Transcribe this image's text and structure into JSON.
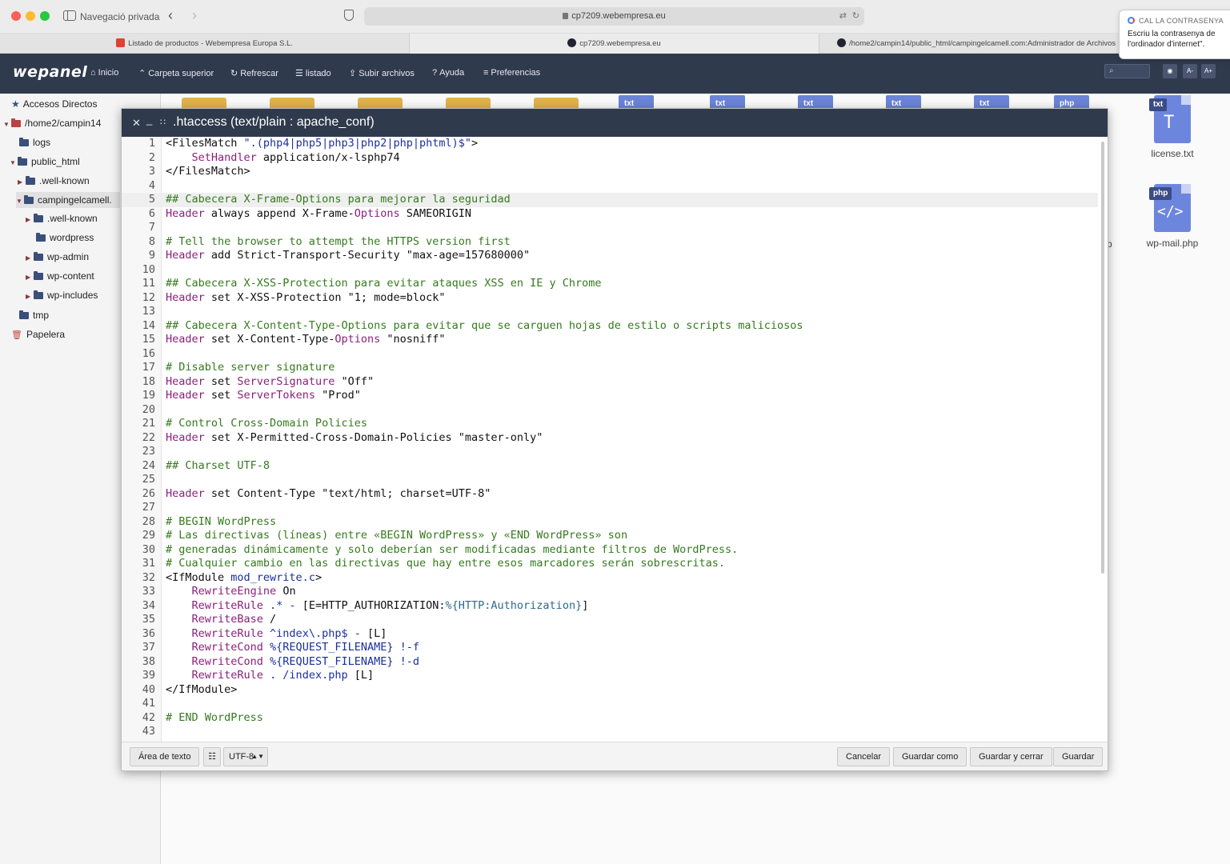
{
  "browser": {
    "private_label": "Navegació privada",
    "address": "cp7209.webempresa.eu",
    "tabs": [
      {
        "title": "Listado de productos - Webempresa Europa S.L."
      },
      {
        "title": "cp7209.webempresa.eu"
      },
      {
        "title": "/home2/campin14/public_html/campingelcamell.com:Administrador de Archivos"
      }
    ]
  },
  "password_popup": {
    "title": "CAL LA CONTRASENYA",
    "text": "Escriu la contrasenya de l'ordinador d'internet\"."
  },
  "app": {
    "logo": "wepanel",
    "toolbar": {
      "home": "Inicio",
      "parent": "Carpeta superior",
      "refresh": "Refrescar",
      "list": "listado",
      "upload": "Subir archivos",
      "help": "Ayuda",
      "prefs": "Preferencias"
    },
    "font_minus": "A-",
    "font_plus": "A+"
  },
  "tree": {
    "shortcuts": "Accesos Directos",
    "root": "/home2/campin14",
    "logs": "logs",
    "public_html": "public_html",
    "well_known_1": ".well-known",
    "campingelcamell": "campingelcamell.",
    "well_known_2": ".well-known",
    "wordpress": "wordpress",
    "wp_admin": "wp-admin",
    "wp_content": "wp-content",
    "wp_includes": "wp-includes",
    "tmp": "tmp",
    "trash": "Papelera"
  },
  "files": {
    "bg_badges": [
      "txt",
      "txt",
      "txt",
      "txt",
      "txt",
      "php"
    ],
    "license": {
      "badge": "txt",
      "name": "license.txt"
    },
    "wp_mail": {
      "badge": "php",
      "name": "wp-mail.php"
    },
    "partial_label": "p"
  },
  "editor": {
    "title": ".htaccess (text/plain : apache_conf)",
    "active_line": 5,
    "lines": [
      [
        [
          "t",
          "<FilesMatch "
        ],
        [
          "s",
          "\".(php4|php5|php3|php2|php|phtml)$\""
        ],
        [
          "t",
          ">"
        ]
      ],
      [
        [
          "t",
          "    "
        ],
        [
          "k",
          "SetHandler"
        ],
        [
          "t",
          " application/x-lsphp74"
        ]
      ],
      [
        [
          "t",
          "</FilesMatch>"
        ]
      ],
      [],
      [
        [
          "c",
          "## Cabecera X-Frame-Options para mejorar la seguridad"
        ]
      ],
      [
        [
          "k",
          "Header"
        ],
        [
          "t",
          " always append X-Frame-"
        ],
        [
          "k",
          "Options"
        ],
        [
          "t",
          " SAMEORIGIN"
        ]
      ],
      [],
      [
        [
          "c",
          "# Tell the browser to attempt the HTTPS version first"
        ]
      ],
      [
        [
          "k",
          "Header"
        ],
        [
          "t",
          " add Strict-Transport-Security \"max-age=157680000\""
        ]
      ],
      [],
      [
        [
          "c",
          "## Cabecera X-XSS-Protection para evitar ataques XSS en IE y Chrome"
        ]
      ],
      [
        [
          "k",
          "Header"
        ],
        [
          "t",
          " set X-XSS-Protection \"1; mode=block\""
        ]
      ],
      [],
      [
        [
          "c",
          "## Cabecera X-Content-Type-Options para evitar que se carguen hojas de estilo o scripts maliciosos"
        ]
      ],
      [
        [
          "k",
          "Header"
        ],
        [
          "t",
          " set X-Content-Type-"
        ],
        [
          "k",
          "Options"
        ],
        [
          "t",
          " \"nosniff\""
        ]
      ],
      [],
      [
        [
          "c",
          "# Disable server signature"
        ]
      ],
      [
        [
          "k",
          "Header"
        ],
        [
          "t",
          " set "
        ],
        [
          "k",
          "ServerSignature"
        ],
        [
          "t",
          " \"Off\""
        ]
      ],
      [
        [
          "k",
          "Header"
        ],
        [
          "t",
          " set "
        ],
        [
          "k",
          "ServerTokens"
        ],
        [
          "t",
          " \"Prod\""
        ]
      ],
      [],
      [
        [
          "c",
          "# Control Cross-Domain Policies"
        ]
      ],
      [
        [
          "k",
          "Header"
        ],
        [
          "t",
          " set X-Permitted-Cross-Domain-Policies \"master-only\""
        ]
      ],
      [],
      [
        [
          "c",
          "## Charset UTF-8"
        ]
      ],
      [],
      [
        [
          "k",
          "Header"
        ],
        [
          "t",
          " set Content-Type \"text/html; charset=UTF-8\""
        ]
      ],
      [],
      [
        [
          "c",
          "# BEGIN WordPress"
        ]
      ],
      [
        [
          "c",
          "# Las directivas (líneas) entre «BEGIN WordPress» y «END WordPress» son"
        ]
      ],
      [
        [
          "c",
          "# generadas dinámicamente y solo deberían ser modificadas mediante filtros de WordPress."
        ]
      ],
      [
        [
          "c",
          "# Cualquier cambio en las directivas que hay entre esos marcadores serán sobrescritas."
        ]
      ],
      [
        [
          "t",
          "<IfModule "
        ],
        [
          "s",
          "mod_rewrite.c"
        ],
        [
          "t",
          ">"
        ]
      ],
      [
        [
          "t",
          "    "
        ],
        [
          "k",
          "RewriteEngine"
        ],
        [
          "t",
          " On"
        ]
      ],
      [
        [
          "t",
          "    "
        ],
        [
          "k",
          "RewriteRule"
        ],
        [
          "s",
          " .* - "
        ],
        [
          "t",
          "[E=HTTP_AUTHORIZATION:"
        ],
        [
          "v",
          "%{HTTP:Authorization}"
        ],
        [
          "t",
          "]"
        ]
      ],
      [
        [
          "t",
          "    "
        ],
        [
          "k",
          "RewriteBase"
        ],
        [
          "t",
          " /"
        ]
      ],
      [
        [
          "t",
          "    "
        ],
        [
          "k",
          "RewriteRule"
        ],
        [
          "s",
          " ^index\\.php$ - "
        ],
        [
          "t",
          "[L]"
        ]
      ],
      [
        [
          "t",
          "    "
        ],
        [
          "k",
          "RewriteCond"
        ],
        [
          "s",
          " %{REQUEST_FILENAME} !-f"
        ]
      ],
      [
        [
          "t",
          "    "
        ],
        [
          "k",
          "RewriteCond"
        ],
        [
          "s",
          " %{REQUEST_FILENAME} !-d"
        ]
      ],
      [
        [
          "t",
          "    "
        ],
        [
          "k",
          "RewriteRule"
        ],
        [
          "s",
          " . /index.php "
        ],
        [
          "t",
          "[L]"
        ]
      ],
      [
        [
          "t",
          "</IfModule>"
        ]
      ],
      [],
      [
        [
          "c",
          "# END WordPress"
        ]
      ],
      []
    ],
    "footer": {
      "textarea": "Área de texto",
      "encoding": "UTF-8",
      "cancel": "Cancelar",
      "save_as": "Guardar como",
      "save_close": "Guardar y cerrar",
      "save": "Guardar"
    }
  },
  "colors": {
    "header_bg": "#2f3a4d",
    "comment": "#357a1e",
    "keyword": "#8b1f7a",
    "string": "#1a2fa0"
  }
}
